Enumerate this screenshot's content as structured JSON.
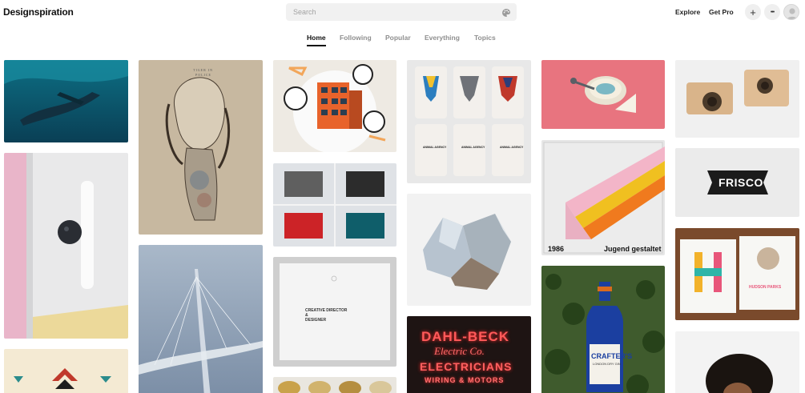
{
  "header": {
    "logo": "Designspiration",
    "search_placeholder": "Search",
    "explore": "Explore",
    "get_pro": "Get Pro",
    "add_symbol": "+",
    "more_symbol": "•••"
  },
  "tabs": [
    {
      "label": "Home",
      "active": true
    },
    {
      "label": "Following",
      "active": false
    },
    {
      "label": "Popular",
      "active": false
    },
    {
      "label": "Everything",
      "active": false
    },
    {
      "label": "Topics",
      "active": false
    }
  ],
  "tiles": {
    "portrait_caption_line1": "TIGER IN",
    "portrait_caption_line2": "POLICE",
    "card_label_1": "CREATIVE DIRECTOR",
    "card_label_2": "&",
    "card_label_3": "DESIGNER",
    "animal_agency": "ANIMAL AGENCY",
    "poster_year": "1986",
    "poster_title": "Jugend gestaltet",
    "frisco": "FRISCO",
    "hudson_text": "HUDSON PARKS",
    "neon_line1": "DAHL-BECK",
    "neon_line2": "Electric Co.",
    "neon_line3": "ELECTRICIANS",
    "neon_line4": "WIRING & MOTORS",
    "bottle_brand": "CRAFTER'S",
    "bottle_sub": "LONDON DRY GIN"
  },
  "colors": {
    "text_primary": "#111111",
    "text_muted": "#8f8f8f",
    "search_bg": "#f1f1f1",
    "pink_tile": "#e8747f",
    "neon_bg": "#1e1413",
    "bottle_blue": "#1b3fa0"
  },
  "icons": [
    "palette-icon",
    "plus-icon",
    "more-icon",
    "avatar-icon"
  ]
}
